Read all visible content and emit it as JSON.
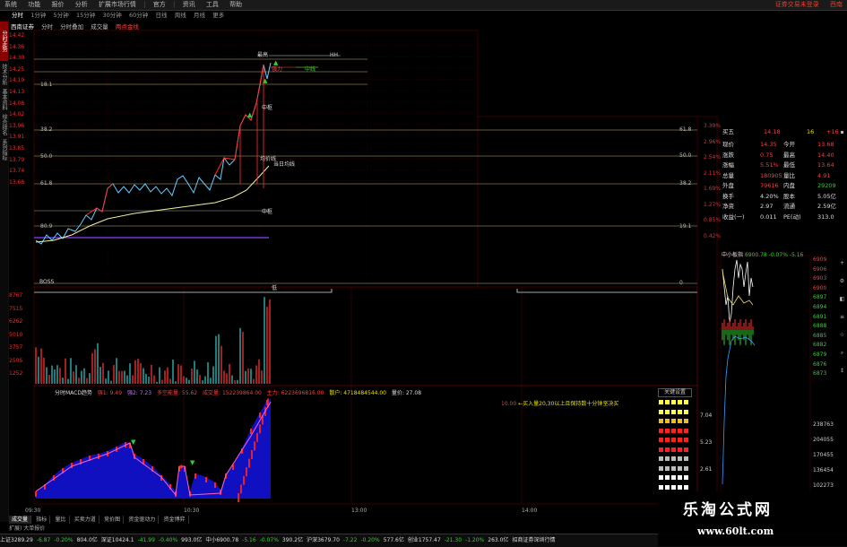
{
  "menu": {
    "items": [
      "系统",
      "功能",
      "报价",
      "分析",
      "扩展市场行情",
      "资讯",
      "工具",
      "帮助"
    ],
    "mid": [
      "官方",
      "资讯",
      "工具"
    ],
    "right_items": [
      "证券交易未登录",
      "西南"
    ]
  },
  "periods": {
    "items": [
      "分时",
      "1分钟",
      "5分钟",
      "15分钟",
      "30分钟",
      "60分钟",
      "日线",
      "周线",
      "月线",
      "更多"
    ],
    "active_index": 0
  },
  "left_tabs": [
    "分时走势",
    "技术分析",
    "基本资料",
    "综合排名",
    "系列指标"
  ],
  "info": {
    "name": "西南证券",
    "mode": "分时",
    "mode2": "分时叠加",
    "vol_label": "成交量",
    "extra": "两点金线"
  },
  "price_axis": [
    "14.42",
    "14.36",
    "14.30",
    "14.25",
    "14.19",
    "14.13",
    "14.08",
    "14.02",
    "13.96",
    "13.91",
    "13.85",
    "13.79",
    "13.74",
    "13.68"
  ],
  "pct_axis": [
    "3.39%",
    "2.96%",
    "2.54%",
    "2.11%",
    "1.69%",
    "1.27%",
    "0.85%",
    "0.42%"
  ],
  "vol_axis": [
    "8767",
    "7515",
    "6262",
    "5010",
    "3757",
    "2505",
    "1252"
  ],
  "fib_levels": [
    "61.8",
    "50.0",
    "38.2",
    "23.6",
    "19.1",
    "0"
  ],
  "fib_left": [
    "18.1",
    "38.2",
    "50.0",
    "61.8",
    "80.9"
  ],
  "annotations": {
    "high": "最高",
    "strong": "强力",
    "mid": "中线",
    "avg": "均价线",
    "low": "低",
    "midline": "中枢",
    "hh": "HH",
    "today": "当日均线",
    "bottom_tag": "BOSS"
  },
  "quote": {
    "title": "买五",
    "title_val": "14.18",
    "title_qty": "16",
    "title_right": "+16",
    "rows": [
      {
        "l": "现价",
        "v": "14.35",
        "l2": "今开",
        "v2": "13.68"
      },
      {
        "l": "涨跌",
        "v": "0.75",
        "l2": "最高",
        "v2": "14.40"
      },
      {
        "l": "涨幅",
        "v": "5.51%",
        "l2": "最低",
        "v2": "13.64"
      },
      {
        "l": "总量",
        "v": "180905",
        "l2": "量比",
        "v2": "4.91"
      },
      {
        "l": "外盘",
        "v": "79616",
        "l2": "内盘",
        "v2": "29209"
      },
      {
        "l": "换手",
        "v": "4.20%",
        "l2": "股本",
        "v2": "5.05亿"
      },
      {
        "l": "净资",
        "v": "2.97",
        "l2": "流通",
        "v2": "2.59亿"
      },
      {
        "l": "收益(一)",
        "v": "0.011",
        "l2": "PE(动)",
        "v2": "313.0"
      }
    ]
  },
  "index_mini": {
    "label": "中小板指",
    "value": "6900.78",
    "change": "-0.07%",
    "change2": "-5.16",
    "axis": [
      "6909",
      "6906",
      "6903",
      "6900",
      "6897",
      "6894",
      "6891",
      "6888",
      "6885",
      "6882",
      "6879",
      "6876",
      "6873"
    ],
    "vol_axis": [
      "7.04",
      "5.23",
      "2.61"
    ],
    "vol_axis2": [
      "238763",
      "204055",
      "170455",
      "136454",
      "102273"
    ]
  },
  "macd": {
    "name": "分时MACD趋势",
    "v1_label": "强1: 9.49",
    "v2_label": "强2: 7.23",
    "v3_label": "多空能量: 55.62",
    "v4_label": "成交量: 152239864.00",
    "v5_label": "主力: 6223696816.00",
    "v6_label": "散户: 4718484544.00",
    "v7_label": "量价: 27.08",
    "note_price": "10.00",
    "note": "←买入量20,30以上且保持数十分钟坚决买",
    "legend_btn": "关键设置"
  },
  "time_axis": [
    "09:30",
    "10:30",
    "13:00",
    "14:00"
  ],
  "bottom_tabs": [
    "成交量",
    "指标",
    "量比",
    "买卖力道",
    "竞价图",
    "资金驱动力",
    "资金博弈"
  ],
  "sub_tabs": "扩展) 大单报价",
  "status": [
    {
      "t": "上证3289.29",
      "c": "white"
    },
    {
      "t": "-6.87",
      "c": "green"
    },
    {
      "t": "-0.20%",
      "c": "green"
    },
    {
      "t": "804.0亿",
      "c": "white"
    },
    {
      "t": "深证10424.1",
      "c": "white"
    },
    {
      "t": "-41.99",
      "c": "green"
    },
    {
      "t": "-0.40%",
      "c": "green"
    },
    {
      "t": "993.0亿",
      "c": "white"
    },
    {
      "t": "中小6900.78",
      "c": "white"
    },
    {
      "t": "-5.16",
      "c": "green"
    },
    {
      "t": "-0.07%",
      "c": "green"
    },
    {
      "t": "390.2亿",
      "c": "white"
    },
    {
      "t": "沪深3679.70",
      "c": "white"
    },
    {
      "t": "-7.22",
      "c": "green"
    },
    {
      "t": "-0.20%",
      "c": "green"
    },
    {
      "t": "577.6亿",
      "c": "white"
    },
    {
      "t": "创业1757.47",
      "c": "white"
    },
    {
      "t": "-21.30",
      "c": "green"
    },
    {
      "t": "-1.20%",
      "c": "green"
    },
    {
      "t": "263.0亿",
      "c": "white"
    },
    {
      "t": "招商证券深圳行情",
      "c": "white"
    }
  ],
  "watermark": {
    "line1": "乐淘公式网",
    "line2": "www.60lt.com"
  },
  "colors": {
    "up": "#ff3b3b",
    "down": "#30d030",
    "grid": "#5a0000",
    "price": "#66ccff",
    "avg": "#f0f0a0"
  }
}
